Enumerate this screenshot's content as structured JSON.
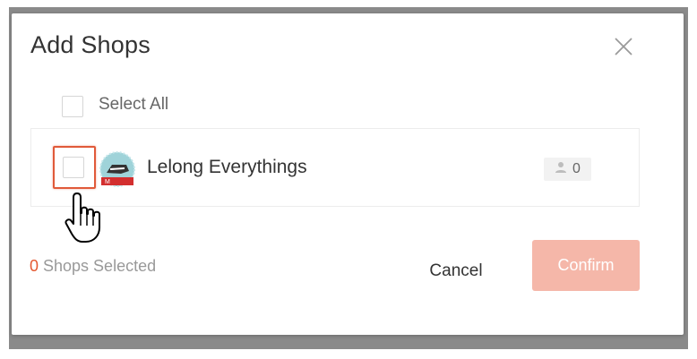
{
  "modal": {
    "title": "Add Shops",
    "close_icon": "close-icon"
  },
  "select_all": {
    "label": "Select All",
    "checked": false
  },
  "shops": [
    {
      "name": "Lelong Everythings",
      "avatar": "shop-avatar-icon",
      "follower_count": "0",
      "checked": false
    }
  ],
  "footer": {
    "selected_count": "0",
    "selected_label": " Shops Selected",
    "cancel_label": "Cancel",
    "confirm_label": "Confirm"
  },
  "colors": {
    "accent": "#e45830",
    "confirm_disabled": "#f5b7a9",
    "highlight": "#e05a3a"
  }
}
